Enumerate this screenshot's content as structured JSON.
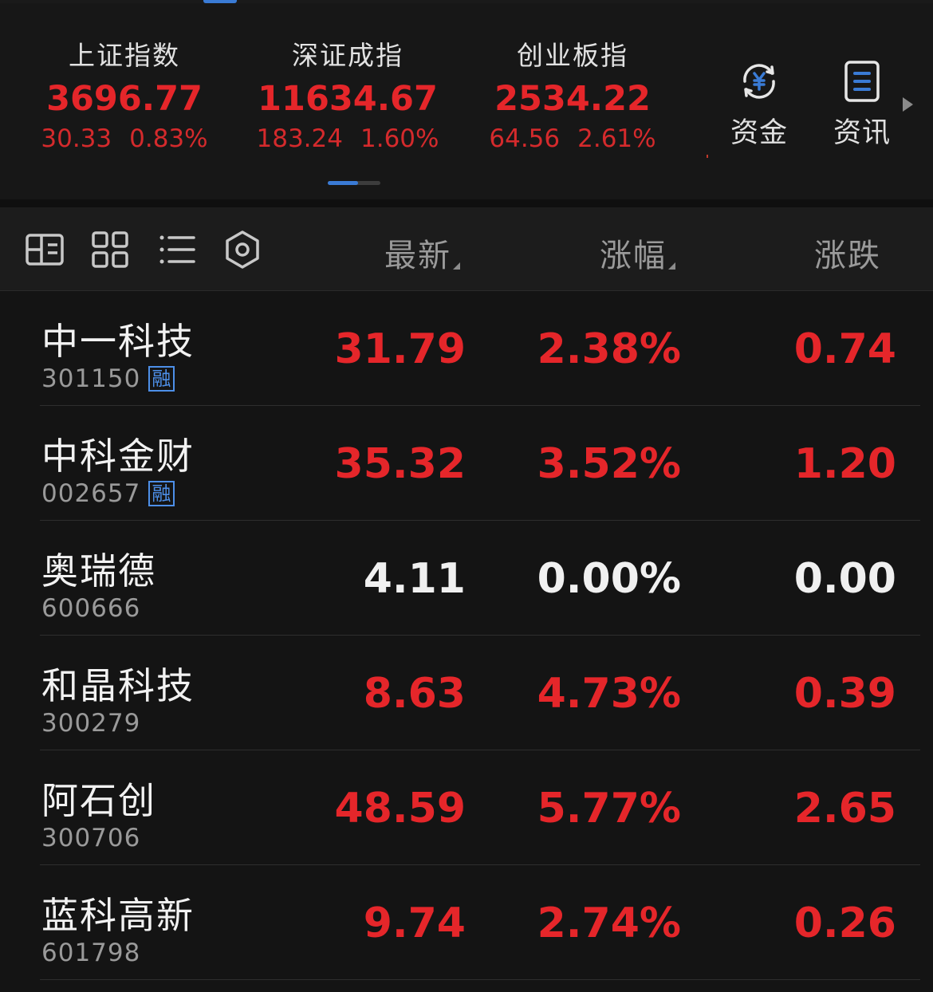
{
  "indices": [
    {
      "name": "上证指数",
      "value": "3696.77",
      "change": "30.33",
      "percent": "0.83%"
    },
    {
      "name": "深证成指",
      "value": "11634.67",
      "change": "183.24",
      "percent": "1.60%"
    },
    {
      "name": "创业板指",
      "value": "2534.22",
      "change": "64.56",
      "percent": "2.61%"
    }
  ],
  "shortcuts": {
    "fund": "资金",
    "news": "资讯"
  },
  "columns": {
    "latest": "最新",
    "percent": "涨幅",
    "change": "涨跌"
  },
  "colors": {
    "up": "#e5262a",
    "flat": "#f0f0f0",
    "accent": "#3a7bd5",
    "background": "#141414"
  },
  "icons": [
    "split-view-icon",
    "grid-view-icon",
    "list-view-icon",
    "settings-hexagon-icon",
    "fund-yuan-icon",
    "news-doc-icon",
    "chevron-right-icon"
  ],
  "stocks": [
    {
      "name": "中一科技",
      "code": "301150",
      "tag": "融",
      "latest": "31.79",
      "percent": "2.38%",
      "change": "0.74",
      "trend": "up"
    },
    {
      "name": "中科金财",
      "code": "002657",
      "tag": "融",
      "latest": "35.32",
      "percent": "3.52%",
      "change": "1.20",
      "trend": "up"
    },
    {
      "name": "奥瑞德",
      "code": "600666",
      "tag": "",
      "latest": "4.11",
      "percent": "0.00%",
      "change": "0.00",
      "trend": "flat"
    },
    {
      "name": "和晶科技",
      "code": "300279",
      "tag": "",
      "latest": "8.63",
      "percent": "4.73%",
      "change": "0.39",
      "trend": "up"
    },
    {
      "name": "阿石创",
      "code": "300706",
      "tag": "",
      "latest": "48.59",
      "percent": "5.77%",
      "change": "2.65",
      "trend": "up"
    },
    {
      "name": "蓝科高新",
      "code": "601798",
      "tag": "",
      "latest": "9.74",
      "percent": "2.74%",
      "change": "0.26",
      "trend": "up"
    }
  ]
}
